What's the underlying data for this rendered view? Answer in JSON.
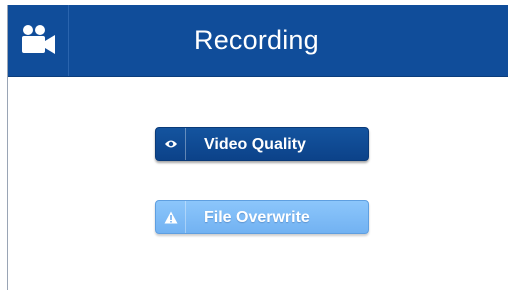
{
  "header": {
    "title": "Recording",
    "icon": "video-camera-icon"
  },
  "menu": [
    {
      "label": "Video Quality",
      "icon": "eye-icon",
      "state": "selected"
    },
    {
      "label": "File Overwrite",
      "icon": "warning-icon",
      "state": "normal"
    }
  ],
  "colors": {
    "header_bg": "#104d9a",
    "selected_button": "#0f4a94",
    "normal_button": "#80bcf7",
    "text": "#ffffff"
  }
}
